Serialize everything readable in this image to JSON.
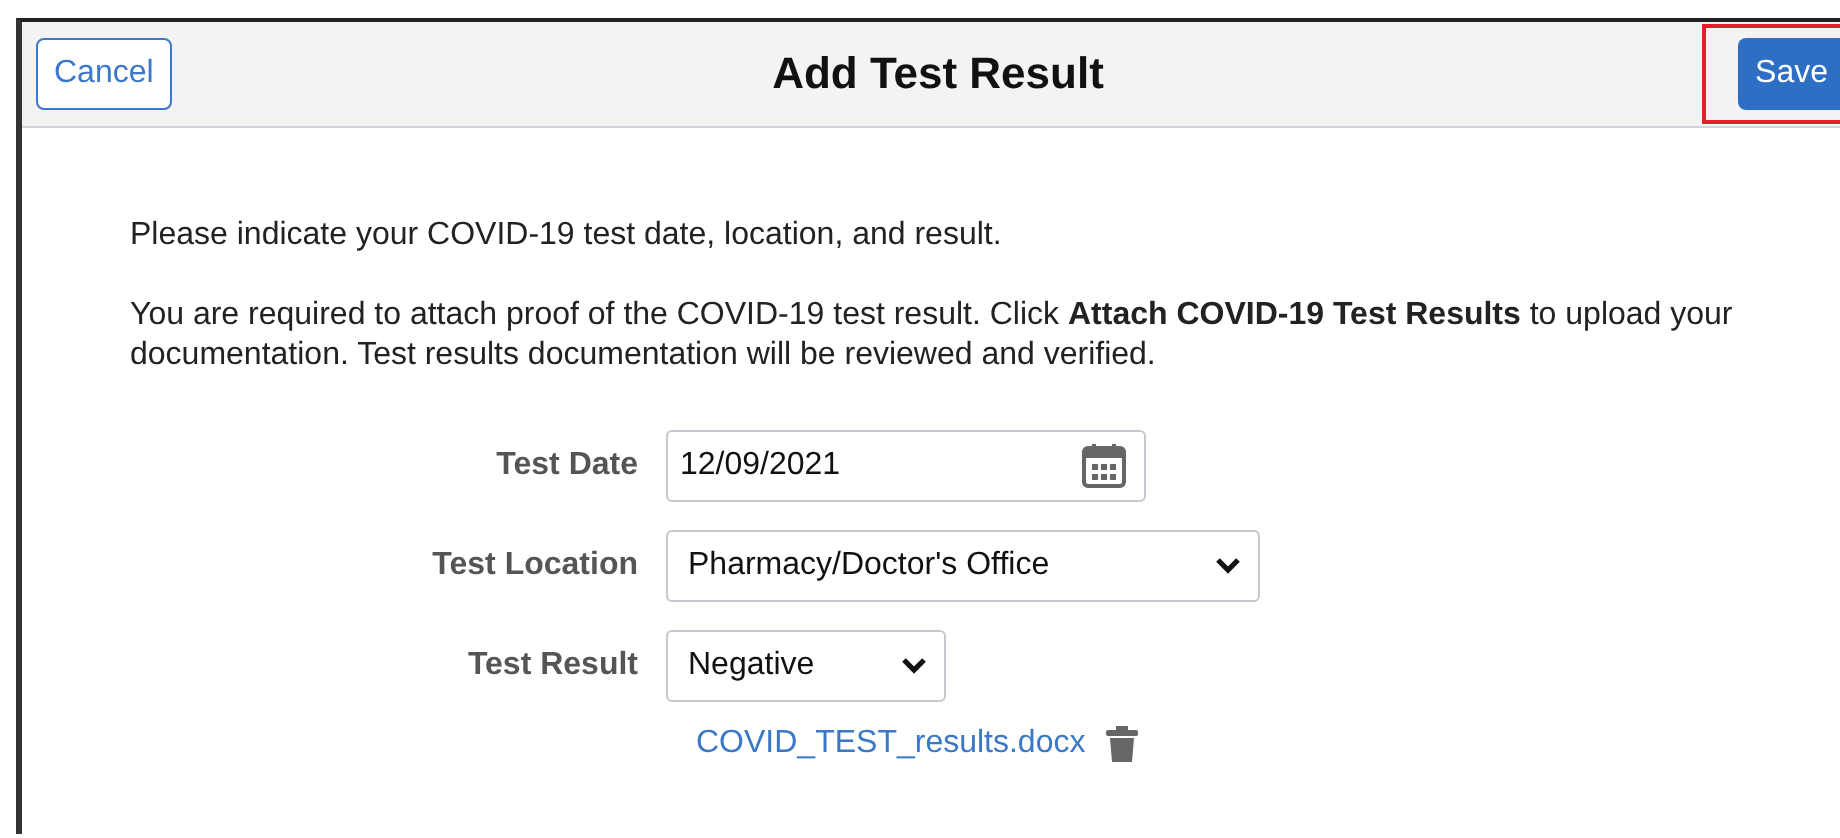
{
  "header": {
    "cancel": "Cancel",
    "title": "Add Test Result",
    "save": {
      "label": "Save",
      "highlighted": true
    }
  },
  "instructions": [
    "Please indicate your COVID-19 test date, location, and result.",
    "You are required to attach proof of the COVID-19 test result. Click **Attach COVID-19 Test Results** to upload your documentation. Test results documentation will be reviewed and verified."
  ],
  "fields": [
    {
      "label": "Test Date",
      "kind": "date",
      "value": "12/09/2021"
    },
    {
      "label": "Test Location",
      "kind": "select",
      "value": "Pharmacy/Doctor's Office"
    },
    {
      "label": "Test Result",
      "kind": "select",
      "value": "Negative"
    }
  ],
  "attachment": {
    "file_name": "COVID_TEST_results.docx"
  }
}
